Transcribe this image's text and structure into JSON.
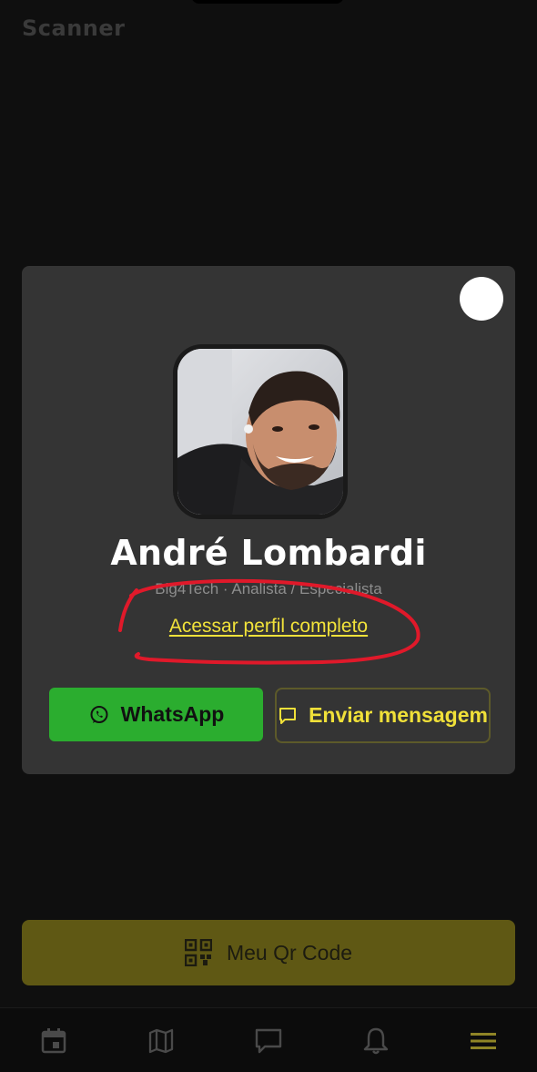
{
  "header": {
    "title": "Scanner"
  },
  "profile_card": {
    "name": "André Lombardi",
    "subtitle": "Big4Tech · Analista / Especialista",
    "profile_link": "Acessar perfil completo",
    "whatsapp_label": "WhatsApp",
    "message_label": "Enviar mensagem"
  },
  "qr_button": {
    "label": "Meu Qr Code"
  },
  "bottom_nav": {
    "items": [
      {
        "icon": "calendar-icon"
      },
      {
        "icon": "map-icon"
      },
      {
        "icon": "chat-icon"
      },
      {
        "icon": "bell-icon"
      },
      {
        "icon": "menu-icon"
      }
    ],
    "active_index": 4
  },
  "colors": {
    "accent": "#f1e23a",
    "whatsapp": "#2bad2f",
    "annotation": "#e0192a"
  }
}
